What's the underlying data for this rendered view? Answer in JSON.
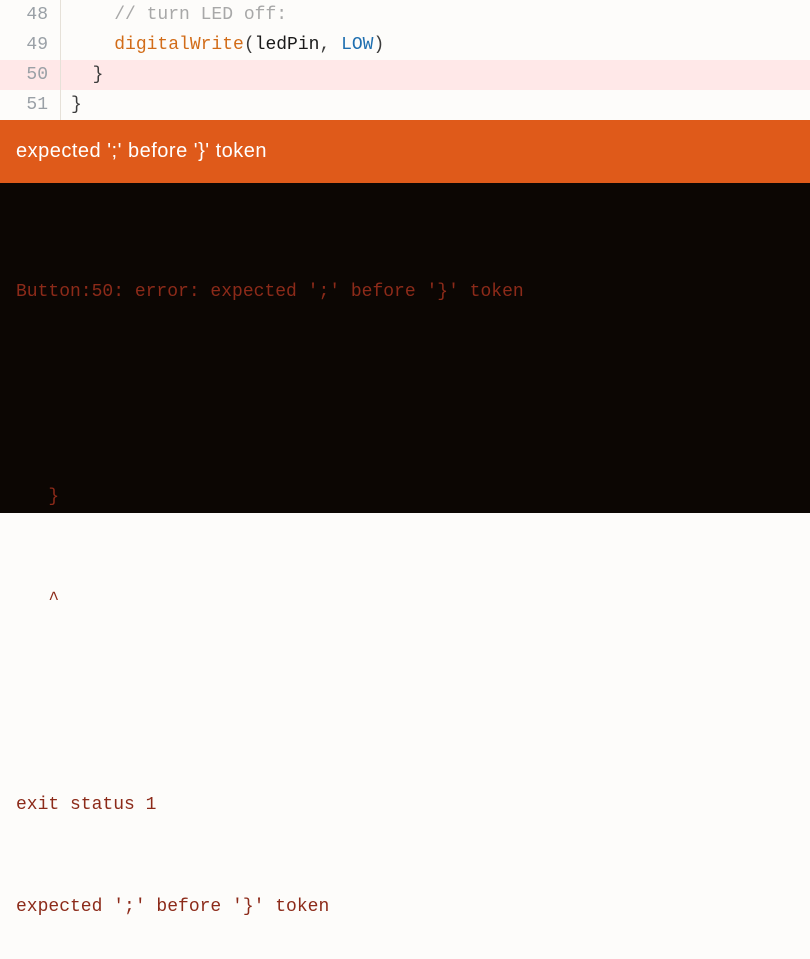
{
  "editor": {
    "lines": [
      {
        "num": "48",
        "highlighted": false,
        "segments": [
          {
            "cls": "tk-plain",
            "text": "    "
          },
          {
            "cls": "tk-comment",
            "text": "// turn LED off:"
          }
        ]
      },
      {
        "num": "49",
        "highlighted": false,
        "segments": [
          {
            "cls": "tk-plain",
            "text": "    "
          },
          {
            "cls": "tk-func",
            "text": "digitalWrite"
          },
          {
            "cls": "tk-punct",
            "text": "("
          },
          {
            "cls": "tk-ident",
            "text": "ledPin"
          },
          {
            "cls": "tk-punct",
            "text": ", "
          },
          {
            "cls": "tk-const",
            "text": "LOW"
          },
          {
            "cls": "tk-punct",
            "text": ")"
          }
        ]
      },
      {
        "num": "50",
        "highlighted": true,
        "segments": [
          {
            "cls": "tk-plain",
            "text": "  "
          },
          {
            "cls": "tk-punct",
            "text": "}"
          }
        ]
      },
      {
        "num": "51",
        "highlighted": false,
        "segments": [
          {
            "cls": "tk-punct",
            "text": "}"
          }
        ]
      }
    ]
  },
  "error_bar": {
    "message": "expected ';' before '}' token"
  },
  "console": {
    "lines": [
      "Button:50: error: expected ';' before '}' token",
      "",
      "   }",
      "   ^",
      "",
      "exit status 1",
      "expected ';' before '}' token"
    ]
  },
  "colors": {
    "accent_orange": "#df5a1a",
    "error_highlight": "#ffe8e8",
    "console_bg": "#0c0603",
    "console_fg": "#8c2a19"
  }
}
